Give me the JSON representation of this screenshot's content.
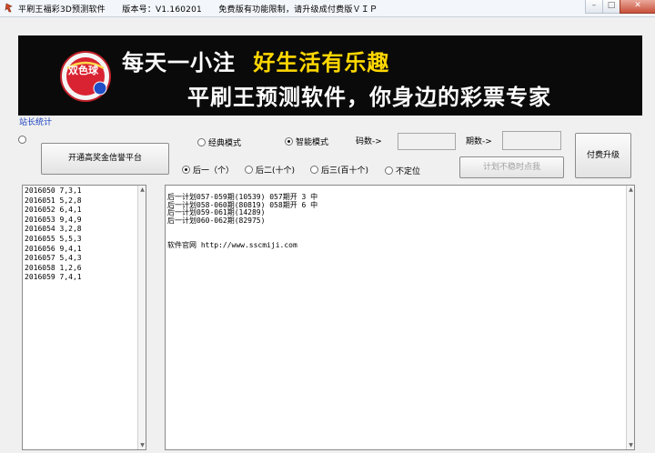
{
  "window": {
    "title": "平刷王福彩3D预测软件　　版本号：V1.160201　　免费版有功能限制，请升级成付费版ＶＩＰ",
    "controls": [
      "minimize",
      "maximize",
      "close"
    ]
  },
  "banner": {
    "logo_text": "双色球",
    "line1_a": "每天一小注",
    "line1_b": "好生活有乐趣",
    "line2": "平刷王预测软件，你身边的彩票专家"
  },
  "stats_link": "站长统计",
  "buttons": {
    "platform": "开通高奖金信誉平台",
    "calc": "计划不稳时点我",
    "upgrade": "付费升级"
  },
  "modes": {
    "classic": "经典模式",
    "smart": "智能模式",
    "selected": "smart"
  },
  "positions": {
    "options": [
      "后一（个）",
      "后二(十个)",
      "后三(百十个)",
      "不定位"
    ],
    "selected": 0
  },
  "fields": {
    "code_label": "码数->",
    "code_value": "",
    "period_label": "期数->",
    "period_value": ""
  },
  "history": [
    "2016050 7,3,1",
    "2016051 5,2,8",
    "2016052 6,4,1",
    "2016053 9,4,9",
    "2016054 3,2,8",
    "2016055 5,5,3",
    "2016056 9,4,1",
    "2016057 5,4,3",
    "2016058 1,2,6",
    "2016059 7,4,1"
  ],
  "output": {
    "lines": [
      "后一计划057-059期(10539)  057期开 3  中",
      "后一计划058-060期(80819)  058期开 6  中",
      "后一计划059-061期(14289)",
      "后一计划060-062期(82975)"
    ],
    "website": "软件官网    http://www.sscmiji.com"
  }
}
